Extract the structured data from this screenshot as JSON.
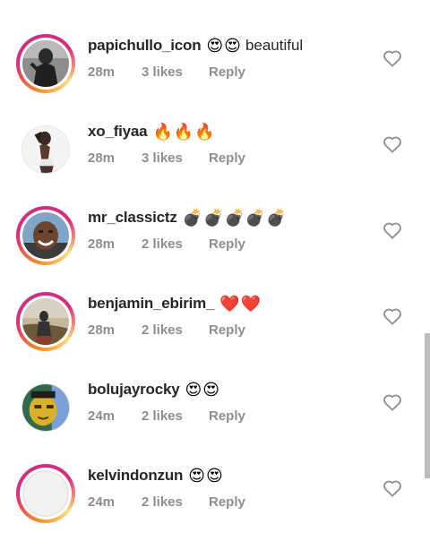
{
  "comments": [
    {
      "username": "papichullo_icon",
      "emojis": "😍😍",
      "text": "beautiful",
      "time": "28m",
      "likes": "3 likes",
      "reply": "Reply",
      "avatar": "avatar-dark-figure"
    },
    {
      "username": "xo_fiyaa",
      "emojis": "🔥🔥🔥",
      "text": "",
      "time": "28m",
      "likes": "3 likes",
      "reply": "Reply",
      "avatar": "avatar-woman-posing"
    },
    {
      "username": "mr_classictz",
      "emojis": "💣💣💣💣💣",
      "text": "",
      "time": "28m",
      "likes": "2 likes",
      "reply": "Reply",
      "avatar": "avatar-smiling-man"
    },
    {
      "username": "benjamin_ebirim_",
      "emojis": "❤️❤️",
      "text": "",
      "time": "28m",
      "likes": "2 likes",
      "reply": "Reply",
      "avatar": "avatar-outdoor-photo"
    },
    {
      "username": "bolujayrocky",
      "emojis": "😍😍",
      "text": "",
      "time": "24m",
      "likes": "2 likes",
      "reply": "Reply",
      "avatar": "avatar-yellow-face"
    },
    {
      "username": "kelvindonzun",
      "emojis": "😍😍",
      "text": "",
      "time": "24m",
      "likes": "2 likes",
      "reply": "Reply",
      "avatar": "avatar-blank"
    }
  ],
  "colors": {
    "username": "#262626",
    "meta": "#8e8e8e",
    "ring_start": "#f58529",
    "ring_mid": "#dd2a7b",
    "heart_stroke": "#8e8e8e",
    "scrollbar": "#bdbdbd"
  },
  "icons": {
    "like": "heart-outline-icon"
  }
}
